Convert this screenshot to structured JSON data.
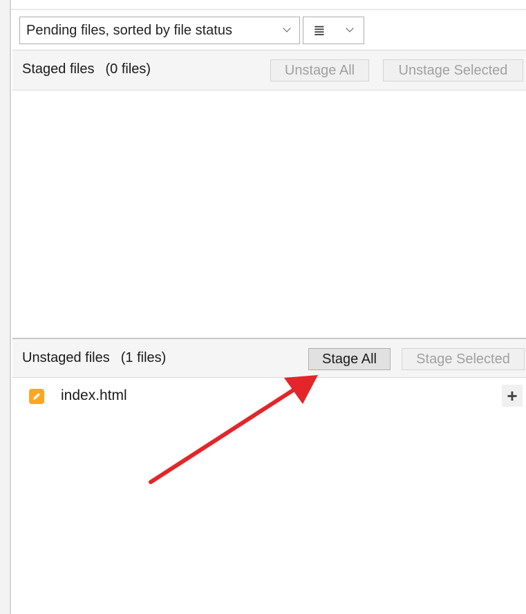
{
  "toolbar": {
    "filter_label": "Pending files, sorted by file status",
    "view_icon": "list-icon",
    "view_glyph": "≣"
  },
  "staged": {
    "title": "Staged files",
    "count": "(0 files)",
    "unstage_all_label": "Unstage All",
    "unstage_selected_label": "Unstage Selected"
  },
  "unstaged": {
    "title": "Unstaged files",
    "count": "(1 files)",
    "stage_all_label": "Stage All",
    "stage_selected_label": "Stage Selected",
    "files": [
      {
        "name": "index.html",
        "status_icon": "modified-file-icon",
        "action_glyph": "+"
      }
    ]
  },
  "colors": {
    "modified_icon": "#ffa51f",
    "annotation_arrow": "#e3262a",
    "header_bg": "#f5f5f5"
  }
}
